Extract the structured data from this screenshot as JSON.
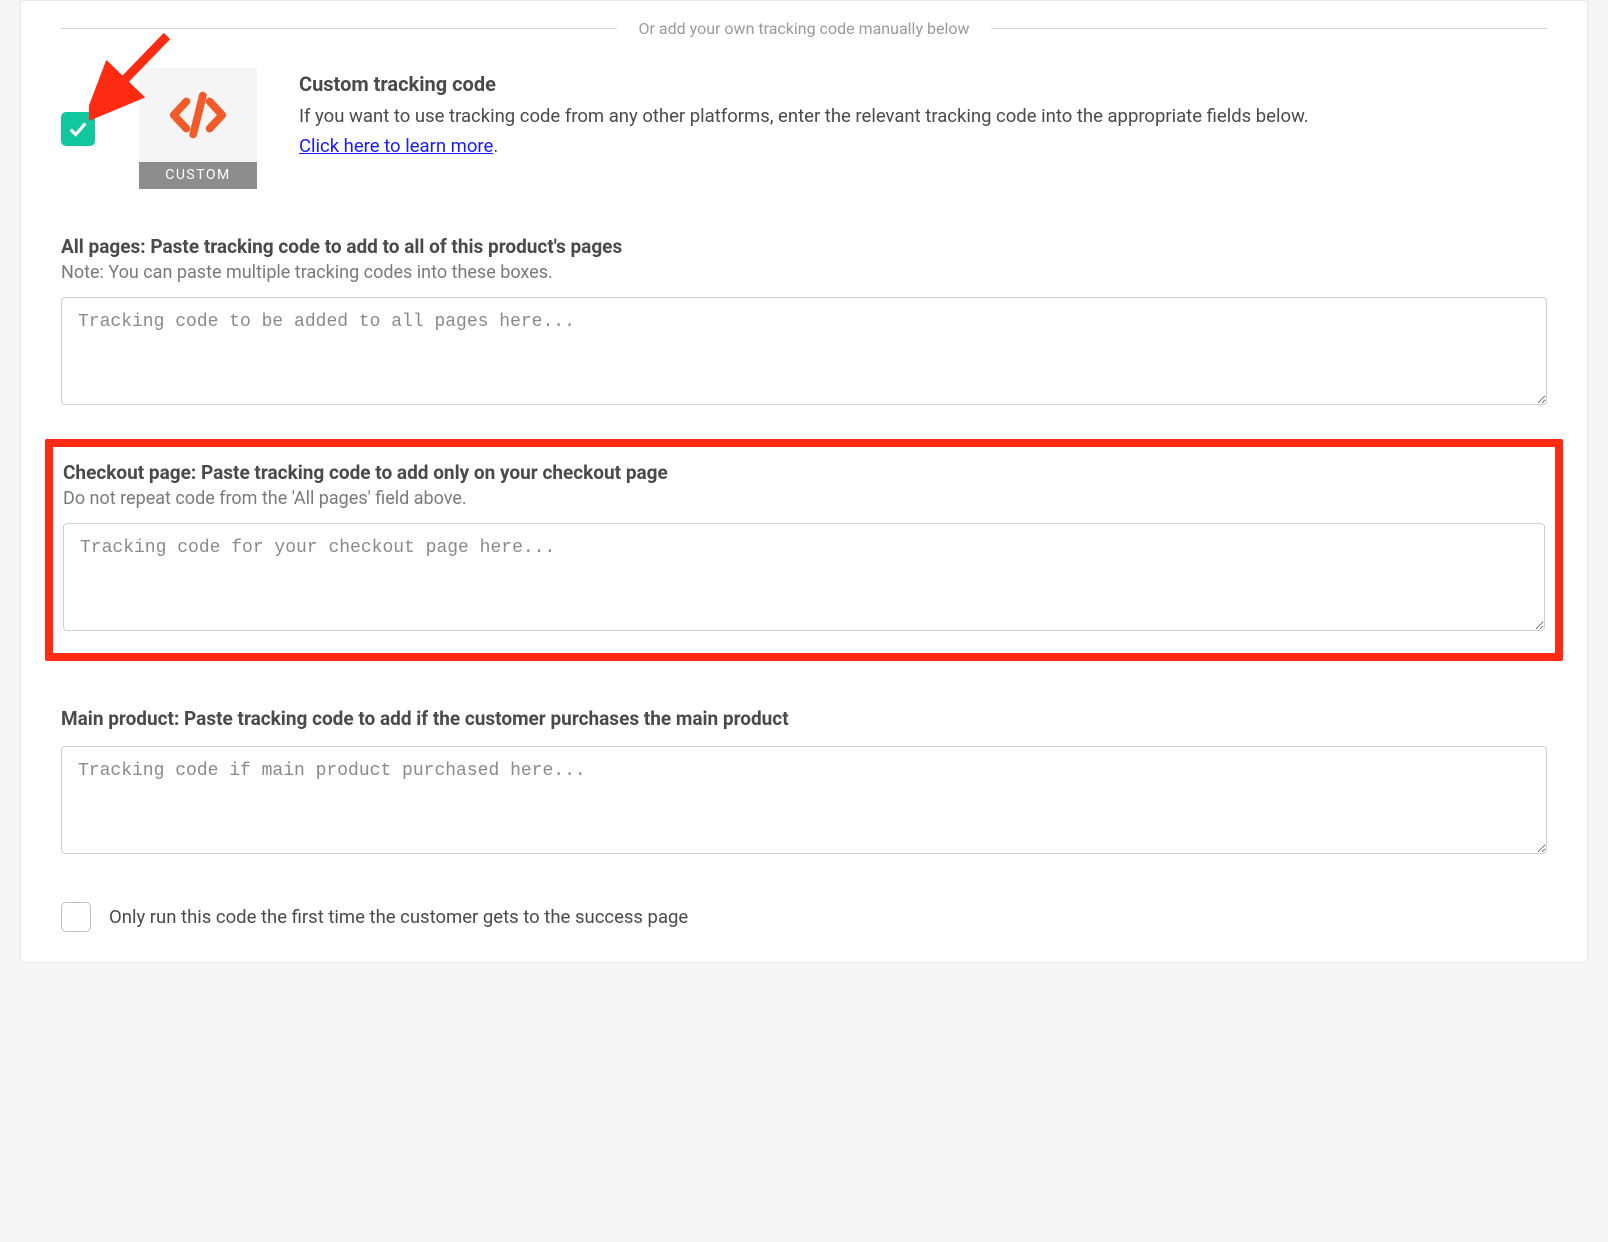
{
  "divider": {
    "text": "Or add your own tracking code manually below"
  },
  "custom": {
    "tile_label": "CUSTOM",
    "title": "Custom tracking code",
    "description": "If you want to use tracking code from any other platforms, enter the relevant tracking code into the appropriate fields below.",
    "learn_more": "Click here to learn more",
    "period": "."
  },
  "sections": {
    "all_pages": {
      "title": "All pages: Paste tracking code to add to all of this product's pages",
      "note": "Note: You can paste multiple tracking codes into these boxes.",
      "placeholder": "Tracking code to be added to all pages here..."
    },
    "checkout": {
      "title": "Checkout page: Paste tracking code to add only on your checkout page",
      "note": "Do not repeat code from the 'All pages' field above.",
      "placeholder": "Tracking code for your checkout page here..."
    },
    "main_product": {
      "title": "Main product: Paste tracking code to add if the customer purchases the main product",
      "placeholder": "Tracking code if main product purchased here..."
    }
  },
  "run_once": {
    "label": "Only run this code the first time the customer gets to the success page"
  }
}
